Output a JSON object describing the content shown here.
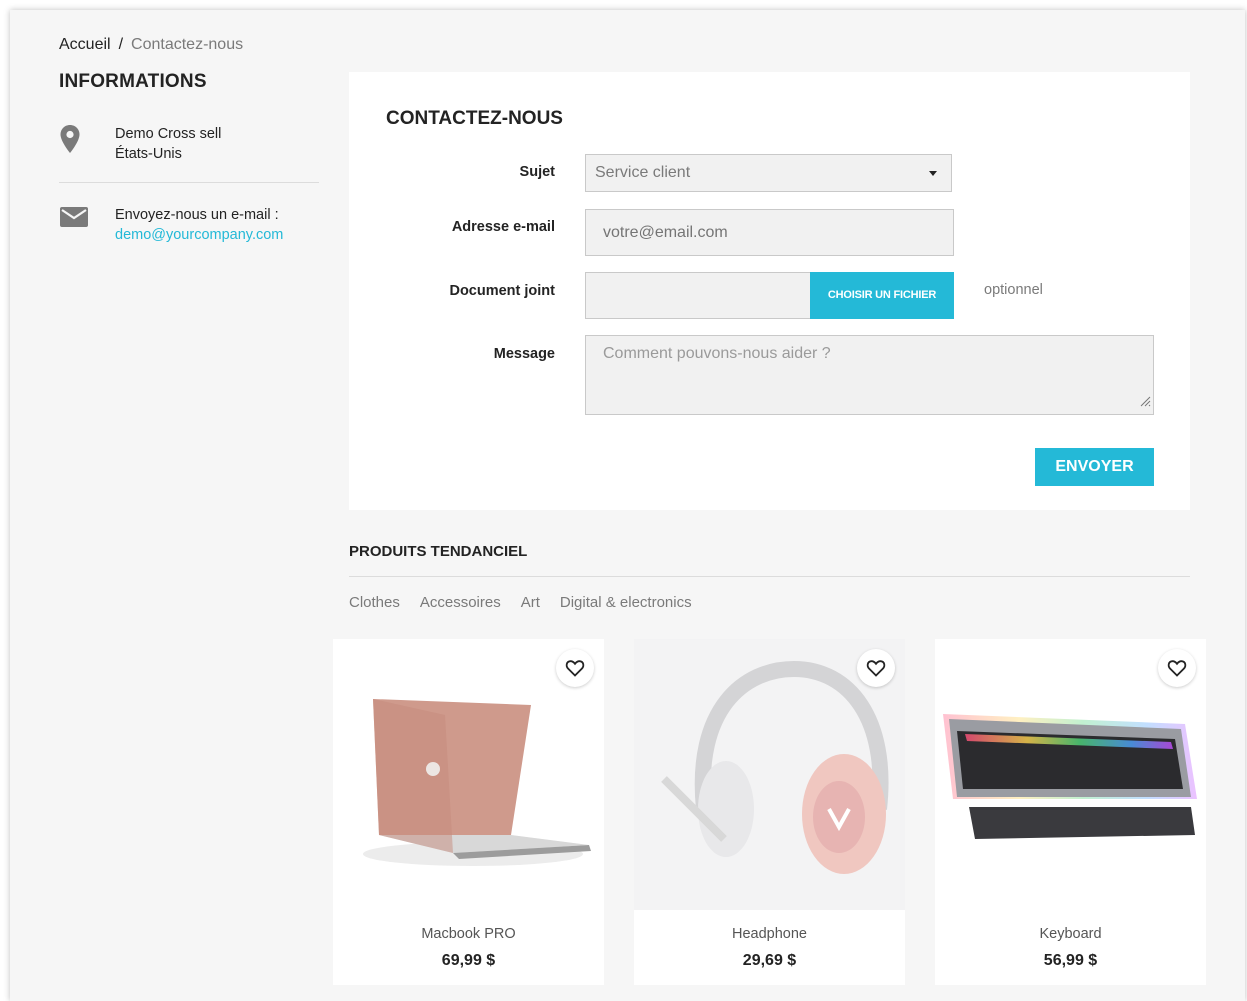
{
  "breadcrumb": {
    "home": "Accueil",
    "separator": "/",
    "current": "Contactez-nous"
  },
  "info": {
    "title": "INFORMATIONS",
    "store_name": "Demo Cross sell",
    "country": "États-Unis",
    "email_label": "Envoyez-nous un e-mail :",
    "email": "demo@yourcompany.com"
  },
  "contact": {
    "title": "CONTACTEZ-NOUS",
    "subject_label": "Sujet",
    "subject_value": "Service client",
    "email_label": "Adresse e-mail",
    "email_placeholder": "votre@email.com",
    "attachment_label": "Document joint",
    "attachment_button": "CHOISIR UN FICHIER",
    "attachment_optional": "optionnel",
    "message_label": "Message",
    "message_placeholder": "Comment pouvons-nous aider ?",
    "send_button": "ENVOYER"
  },
  "trending": {
    "title": "PRODUITS TENDANCIEL",
    "tabs": [
      "Clothes",
      "Accessoires",
      "Art",
      "Digital & electronics"
    ],
    "products": [
      {
        "name": "Macbook PRO",
        "price": "69,99 $"
      },
      {
        "name": "Headphone",
        "price": "29,69 $"
      },
      {
        "name": "Keyboard",
        "price": "56,99 $"
      }
    ]
  },
  "colors": {
    "accent": "#24b9d7",
    "text": "#232323",
    "muted": "#7a7a7a",
    "background": "#f6f6f6"
  }
}
